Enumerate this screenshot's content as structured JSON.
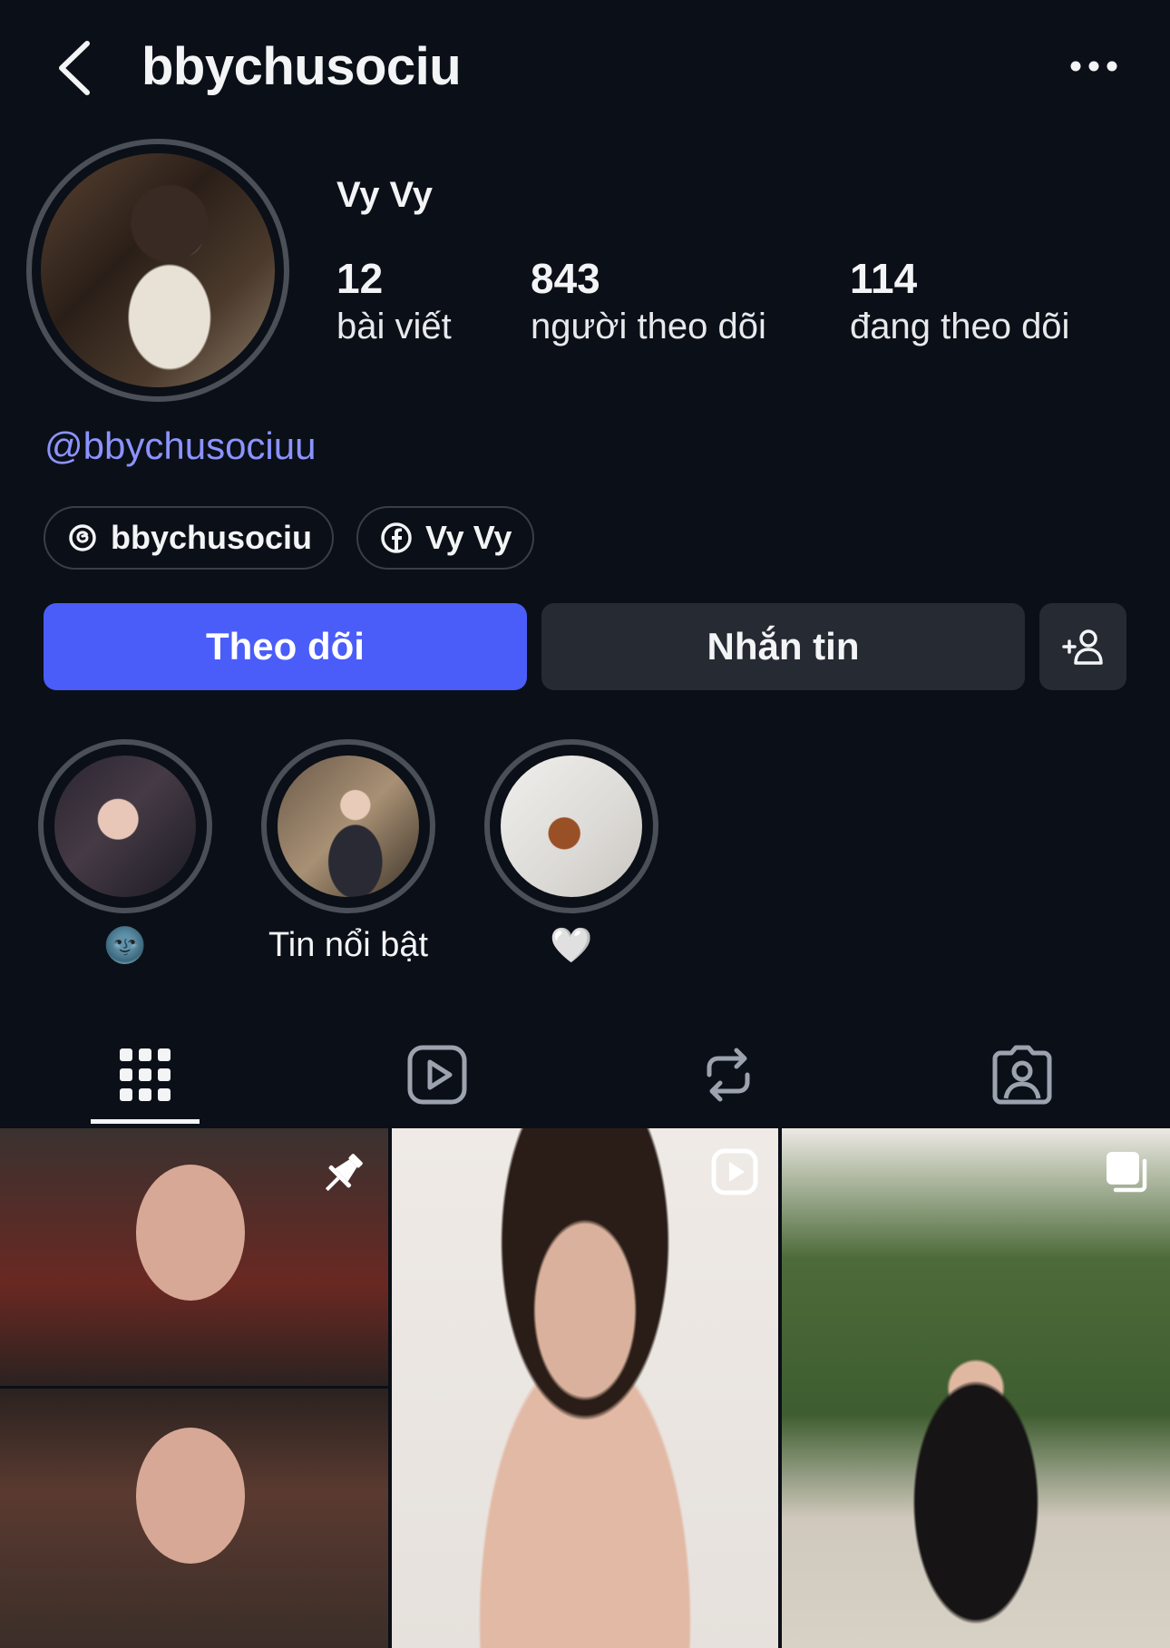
{
  "header": {
    "username": "bbychusociu",
    "back_icon": "chevron-left-icon",
    "more_icon": "more-horizontal-icon"
  },
  "profile": {
    "display_name": "Vy Vy",
    "handle": "@bbychusociuu",
    "stats": {
      "posts_count": "12",
      "posts_label": "bài viết",
      "followers_count": "843",
      "followers_label": "người theo dõi",
      "following_count": "114",
      "following_label": "đang theo dõi"
    },
    "links": [
      {
        "icon": "threads-icon",
        "label": "bbychusociu"
      },
      {
        "icon": "facebook-icon",
        "label": "Vy Vy"
      }
    ]
  },
  "actions": {
    "follow_label": "Theo dõi",
    "message_label": "Nhắn tin",
    "add_user_icon": "add-user-icon"
  },
  "highlights": [
    {
      "label": "🌚"
    },
    {
      "label": "Tin nổi bật"
    },
    {
      "label": "🤍"
    }
  ],
  "tabs": [
    {
      "name": "grid",
      "icon": "grid-icon",
      "selected": true
    },
    {
      "name": "reels",
      "icon": "reels-icon",
      "selected": false
    },
    {
      "name": "reposts",
      "icon": "repost-icon",
      "selected": false
    },
    {
      "name": "tagged",
      "icon": "tagged-person-icon",
      "selected": false
    }
  ],
  "posts": [
    {
      "badge_icon": "pin-icon"
    },
    {
      "badge_icon": "reel-play-icon"
    },
    {
      "badge_icon": "carousel-icon"
    }
  ],
  "colors": {
    "background": "#0b0f17",
    "accent": "#4a5df9",
    "handle": "#8b93ff",
    "button_secondary": "#262a33"
  }
}
